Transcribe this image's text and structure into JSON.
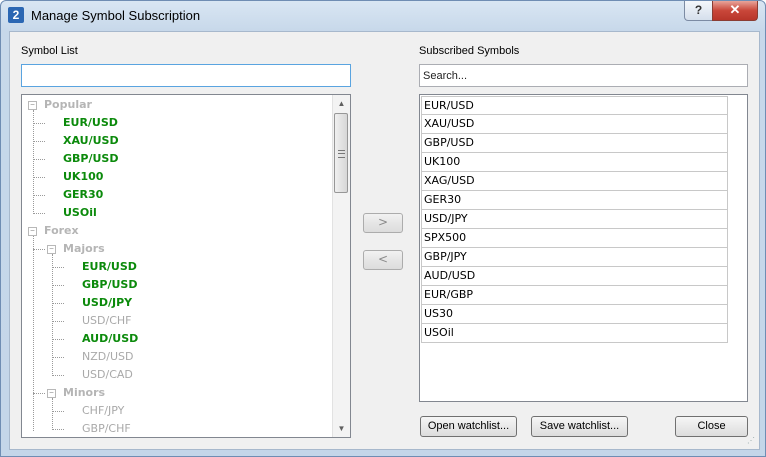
{
  "window": {
    "title": "Manage Symbol Subscription",
    "app_icon_glyph": "2",
    "help_glyph": "?",
    "close_glyph": "✕"
  },
  "left": {
    "label": "Symbol List",
    "search_value": ""
  },
  "tree": {
    "groups": [
      {
        "label": "Popular",
        "items": [
          {
            "label": "EUR/USD",
            "subscribed": true
          },
          {
            "label": "XAU/USD",
            "subscribed": true
          },
          {
            "label": "GBP/USD",
            "subscribed": true
          },
          {
            "label": "UK100",
            "subscribed": true
          },
          {
            "label": "GER30",
            "subscribed": true
          },
          {
            "label": "USOil",
            "subscribed": true
          }
        ]
      },
      {
        "label": "Forex",
        "subgroups": [
          {
            "label": "Majors",
            "items": [
              {
                "label": "EUR/USD",
                "subscribed": true
              },
              {
                "label": "GBP/USD",
                "subscribed": true
              },
              {
                "label": "USD/JPY",
                "subscribed": true
              },
              {
                "label": "USD/CHF",
                "subscribed": false
              },
              {
                "label": "AUD/USD",
                "subscribed": true
              },
              {
                "label": "NZD/USD",
                "subscribed": false
              },
              {
                "label": "USD/CAD",
                "subscribed": false
              }
            ]
          },
          {
            "label": "Minors",
            "items": [
              {
                "label": "CHF/JPY",
                "subscribed": false
              },
              {
                "label": "GBP/CHF",
                "subscribed": false
              }
            ]
          }
        ]
      }
    ]
  },
  "buttons": {
    "add": ">",
    "remove": "<",
    "open_watchlist": "Open watchlist...",
    "save_watchlist": "Save watchlist...",
    "close": "Close"
  },
  "right": {
    "label": "Subscribed Symbols",
    "search_placeholder": "Search...",
    "symbols": [
      "EUR/USD",
      "XAU/USD",
      "GBP/USD",
      "UK100",
      "XAG/USD",
      "GER30",
      "USD/JPY",
      "SPX500",
      "GBP/JPY",
      "AUD/USD",
      "EUR/GBP",
      "US30",
      "USOil"
    ]
  },
  "colors": {
    "subscribed": "#0b8a0b",
    "unsubscribed": "#a9a9a9",
    "title_bar": "#c7d8ea"
  }
}
